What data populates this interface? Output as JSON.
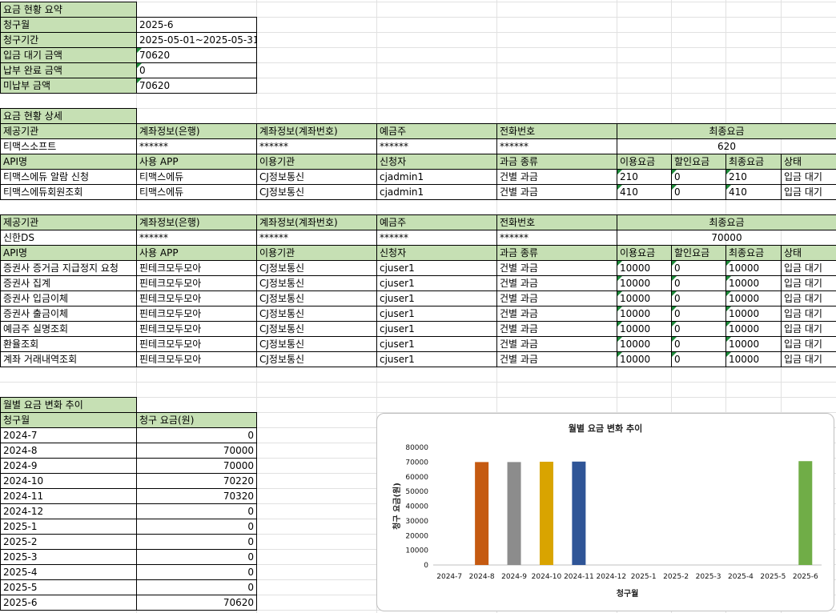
{
  "summary": {
    "title": "요금 현황 요약",
    "rows": [
      {
        "label": "청구월",
        "value": "2025-6"
      },
      {
        "label": "청구기간",
        "value": "2025-05-01~2025-05-31"
      },
      {
        "label": "입금 대기 금액",
        "value": "70620"
      },
      {
        "label": "납부 완료 금액",
        "value": "0"
      },
      {
        "label": "미납부 금액",
        "value": "70620"
      }
    ]
  },
  "detail": {
    "title": "요금 현황 상세",
    "provider_header": [
      "제공기관",
      "계좌정보(은행)",
      "계좌정보(계좌번호)",
      "예금주",
      "전화번호",
      "최종요금"
    ],
    "api_header": [
      "API명",
      "사용 APP",
      "이용기관",
      "신청자",
      "과금 종류",
      "이용요금",
      "할인요금",
      "최종요금",
      "상태"
    ],
    "providers": [
      {
        "name": "티맥스소프트",
        "bank": "******",
        "account": "******",
        "holder": "******",
        "phone": "******",
        "total": "620",
        "apis": [
          [
            "티맥스에듀 알람 신청",
            "티맥스에듀",
            "CJ정보통신",
            "cjadmin1",
            "건별 과금",
            "210",
            "0",
            "210",
            "입금 대기"
          ],
          [
            "티맥스에듀회원조회",
            "티맥스에듀",
            "CJ정보통신",
            "cjadmin1",
            "건별 과금",
            "410",
            "0",
            "410",
            "입금 대기"
          ]
        ]
      },
      {
        "name": "신한DS",
        "bank": "******",
        "account": "******",
        "holder": "******",
        "phone": "******",
        "total": "70000",
        "apis": [
          [
            "증권사 증거금 지급정지 요청",
            "핀테크모두모아",
            "CJ정보통신",
            "cjuser1",
            "건별 과금",
            "10000",
            "0",
            "10000",
            "입금 대기"
          ],
          [
            "증권사 집계",
            "핀테크모두모아",
            "CJ정보통신",
            "cjuser1",
            "건별 과금",
            "10000",
            "0",
            "10000",
            "입금 대기"
          ],
          [
            "증권사 입금이체",
            "핀테크모두모아",
            "CJ정보통신",
            "cjuser1",
            "건별 과금",
            "10000",
            "0",
            "10000",
            "입금 대기"
          ],
          [
            "증권사 출금이체",
            "핀테크모두모아",
            "CJ정보통신",
            "cjuser1",
            "건별 과금",
            "10000",
            "0",
            "10000",
            "입금 대기"
          ],
          [
            "예금주 실명조회",
            "핀테크모두모아",
            "CJ정보통신",
            "cjuser1",
            "건별 과금",
            "10000",
            "0",
            "10000",
            "입금 대기"
          ],
          [
            "환율조회",
            "핀테크모두모아",
            "CJ정보통신",
            "cjuser1",
            "건별 과금",
            "10000",
            "0",
            "10000",
            "입금 대기"
          ],
          [
            "계좌 거래내역조회",
            "핀테크모두모아",
            "CJ정보통신",
            "cjuser1",
            "건별 과금",
            "10000",
            "0",
            "10000",
            "입금 대기"
          ]
        ]
      }
    ]
  },
  "monthly": {
    "title": "월별 요금 변화 추이",
    "headers": [
      "청구월",
      "청구 요금(원)"
    ],
    "rows": [
      [
        "2024-7",
        "0"
      ],
      [
        "2024-8",
        "70000"
      ],
      [
        "2024-9",
        "70000"
      ],
      [
        "2024-10",
        "70220"
      ],
      [
        "2024-11",
        "70320"
      ],
      [
        "2024-12",
        "0"
      ],
      [
        "2025-1",
        "0"
      ],
      [
        "2025-2",
        "0"
      ],
      [
        "2025-3",
        "0"
      ],
      [
        "2025-4",
        "0"
      ],
      [
        "2025-5",
        "0"
      ],
      [
        "2025-6",
        "70620"
      ]
    ]
  },
  "chart_data": {
    "type": "bar",
    "title": "월별 요금 변화 추이",
    "xlabel": "청구월",
    "ylabel": "청구 요금(원)",
    "categories": [
      "2024-7",
      "2024-8",
      "2024-9",
      "2024-10",
      "2024-11",
      "2024-12",
      "2025-1",
      "2025-2",
      "2025-3",
      "2025-4",
      "2025-5",
      "2025-6"
    ],
    "values": [
      0,
      70000,
      70000,
      70220,
      70320,
      0,
      0,
      0,
      0,
      0,
      0,
      70620
    ],
    "bar_colors": [
      "#c55a11",
      "#c55a11",
      "#8c8c8c",
      "#d9a400",
      "#2f5597",
      "#c55a11",
      "#c55a11",
      "#c55a11",
      "#c55a11",
      "#c55a11",
      "#c55a11",
      "#70ad47"
    ],
    "yticks": [
      0,
      10000,
      20000,
      30000,
      40000,
      50000,
      60000,
      70000,
      80000
    ],
    "ylim": [
      0,
      80000
    ],
    "grid": false,
    "legend": "none"
  }
}
